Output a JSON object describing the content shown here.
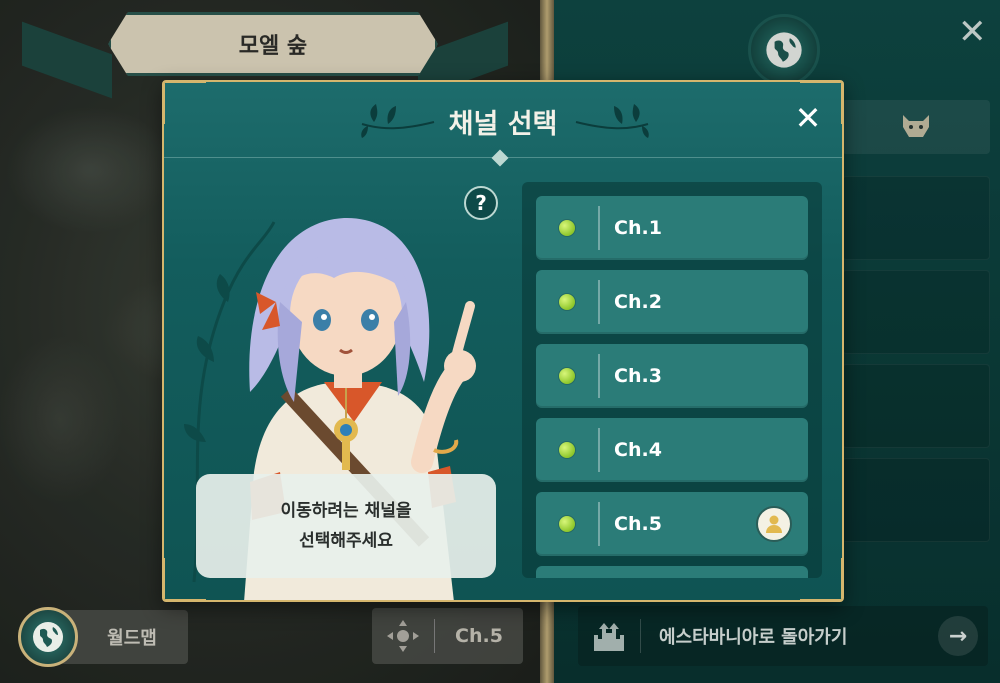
{
  "map": {
    "area_name": "모엘 숲",
    "worldmap_label": "월드맵",
    "current_channel_label": "Ch.5"
  },
  "region_panel": {
    "close_symbol": "✕",
    "return_label": "에스타바니아로 돌아가기",
    "return_arrow": "→"
  },
  "channel_dialog": {
    "title": "채널 선택",
    "close_symbol": "✕",
    "help_symbol": "?",
    "guide_line1": "이동하려는 채널을",
    "guide_line2": "선택해주세요",
    "channels": [
      {
        "label": "Ch.1",
        "status": "normal",
        "current": false
      },
      {
        "label": "Ch.2",
        "status": "normal",
        "current": false
      },
      {
        "label": "Ch.3",
        "status": "normal",
        "current": false
      },
      {
        "label": "Ch.4",
        "status": "normal",
        "current": false
      },
      {
        "label": "Ch.5",
        "status": "normal",
        "current": true
      }
    ],
    "status_color": "#9bd13a"
  },
  "colors": {
    "accent_gold": "#d5b66d",
    "panel_teal": "#135d5d",
    "channel_button": "#2b7c78"
  },
  "icons": {
    "globe": "globe-icon",
    "move": "move-arrows-icon",
    "castle": "castle-icon",
    "wolf": "wolf-icon",
    "user": "user-icon"
  }
}
